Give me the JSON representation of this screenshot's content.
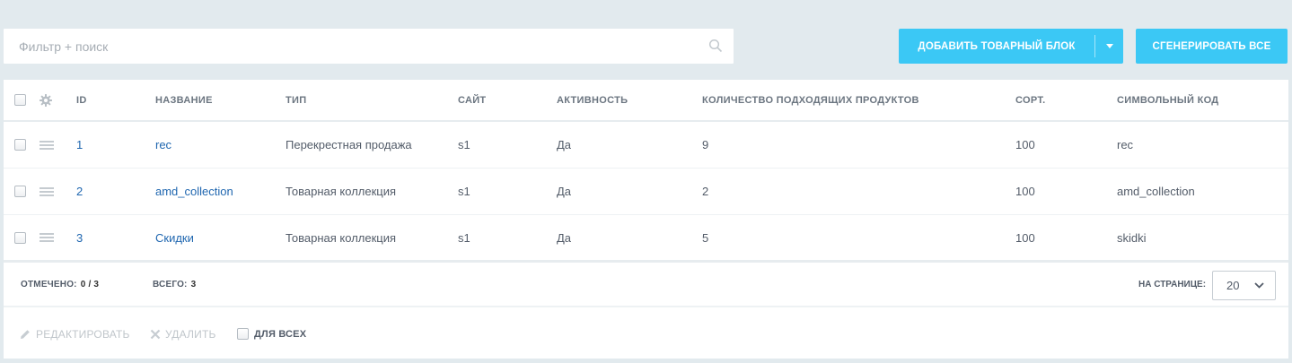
{
  "filter": {
    "placeholder": "Фильтр + поиск"
  },
  "toolbar": {
    "add_label": "ДОБАВИТЬ ТОВАРНЫЙ БЛОК",
    "generate_label": "СГЕНЕРИРОВАТЬ ВСЕ"
  },
  "table": {
    "columns": {
      "id": "ID",
      "name": "НАЗВАНИЕ",
      "type": "ТИП",
      "site": "САЙТ",
      "active": "АКТИВНОСТЬ",
      "qty": "КОЛИЧЕСТВО ПОДХОДЯЩИХ ПРОДУКТОВ",
      "sort": "СОРТ.",
      "code": "СИМВОЛЬНЫЙ КОД"
    },
    "rows": [
      {
        "id": "1",
        "name": "rec",
        "type": "Перекрестная продажа",
        "site": "s1",
        "active": "Да",
        "qty": "9",
        "sort": "100",
        "code": "rec"
      },
      {
        "id": "2",
        "name": "amd_collection",
        "type": "Товарная коллекция",
        "site": "s1",
        "active": "Да",
        "qty": "2",
        "sort": "100",
        "code": "amd_collection"
      },
      {
        "id": "3",
        "name": "Скидки",
        "type": "Товарная коллекция",
        "site": "s1",
        "active": "Да",
        "qty": "5",
        "sort": "100",
        "code": "skidki"
      }
    ]
  },
  "footer": {
    "selected_label": "ОТМЕЧЕНО:",
    "selected_value": "0 / 3",
    "total_label": "ВСЕГО:",
    "total_value": "3",
    "per_page_label": "НА СТРАНИЦЕ:",
    "per_page_value": "20"
  },
  "actions": {
    "edit_label": "РЕДАКТИРОВАТЬ",
    "delete_label": "УДАЛИТЬ",
    "for_all_label": "ДЛЯ ВСЕХ"
  },
  "colors": {
    "accent": "#3bc8f5",
    "link": "#2067b0",
    "background": "#e2eaee"
  }
}
